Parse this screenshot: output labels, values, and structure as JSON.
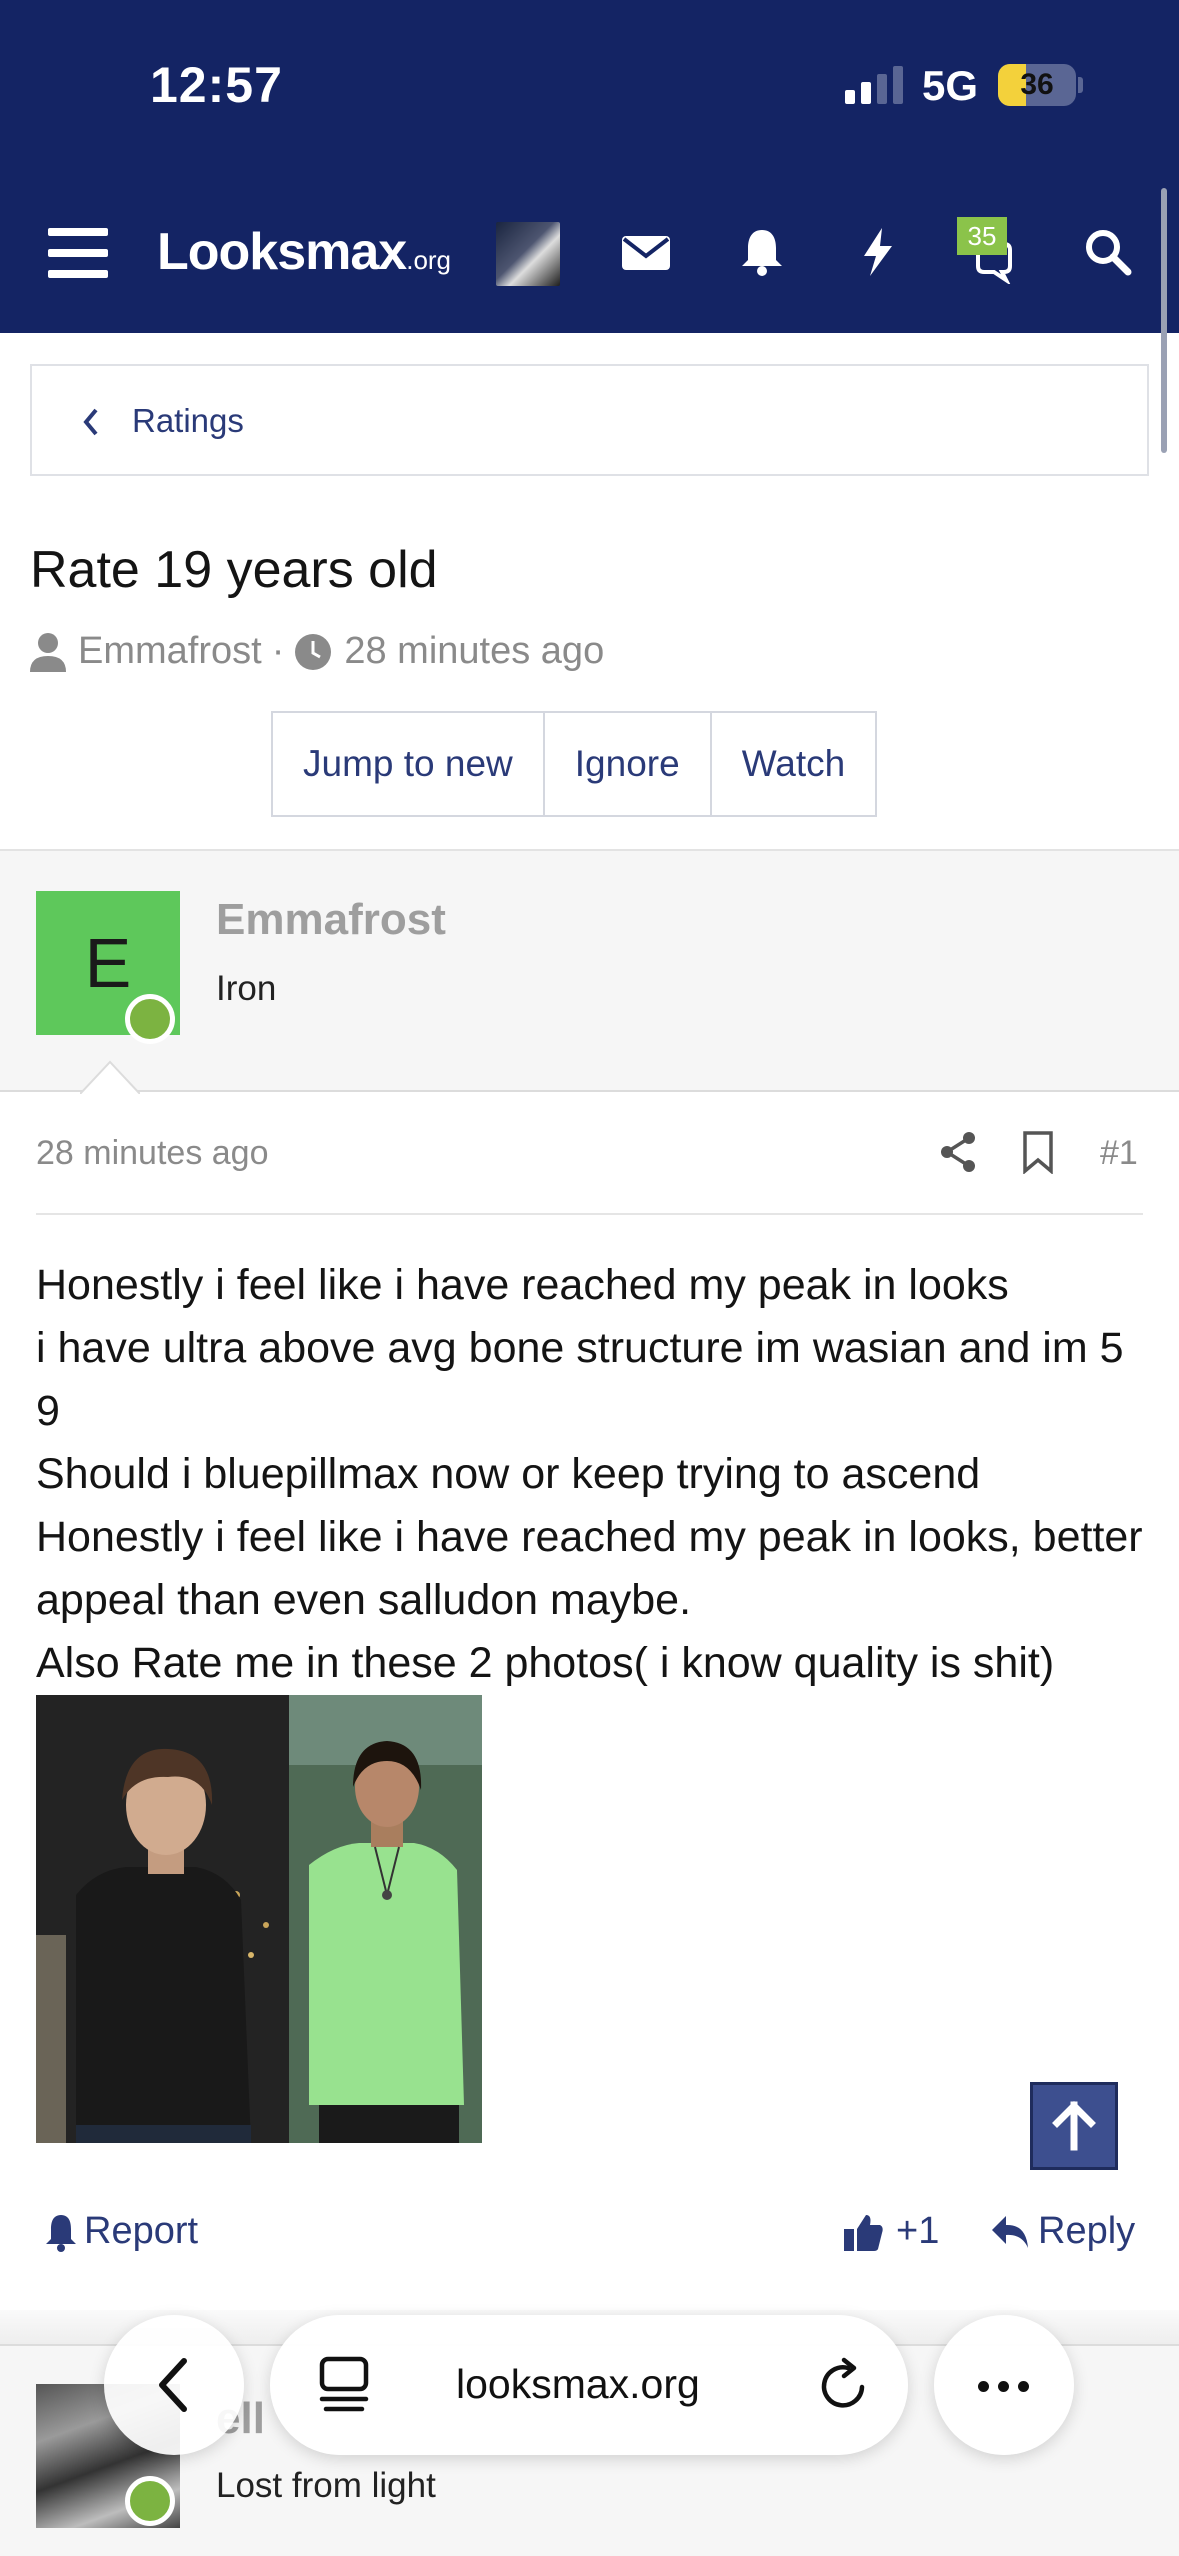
{
  "status": {
    "time": "12:57",
    "network": "5G",
    "battery": "36"
  },
  "header": {
    "logo_main": "Lksmax",
    "logo_oo": "oo",
    "logo_org": ".org",
    "logo_text": "Looksmax",
    "conversations_badge": "35"
  },
  "breadcrumb": {
    "label": "Ratings"
  },
  "thread": {
    "title": "Rate 19 years old",
    "author": "Emmafrost",
    "separator": "·",
    "time": "28 minutes ago",
    "buttons": {
      "jump": "Jump to new",
      "ignore": "Ignore",
      "watch": "Watch"
    }
  },
  "post": {
    "avatar_letter": "E",
    "username": "Emmafrost",
    "rank": "Iron",
    "time": "28 minutes ago",
    "number": "#1",
    "lines": [
      "Honestly i feel like i have reached my peak in looks",
      "i have ultra above avg bone structure im wasian and im 5 9",
      "Should i bluepillmax now or keep trying to ascend",
      "Honestly i feel like i have reached my peak in looks, better appeal than even salludon maybe.",
      "Also Rate me in these 2 photos( i know quality is shit)"
    ],
    "actions": {
      "report": "Report",
      "like": "+1",
      "reply": "Reply"
    }
  },
  "next_post": {
    "username": "ell",
    "rank": "Lost from light"
  },
  "browser": {
    "url": "looksmax.org"
  }
}
